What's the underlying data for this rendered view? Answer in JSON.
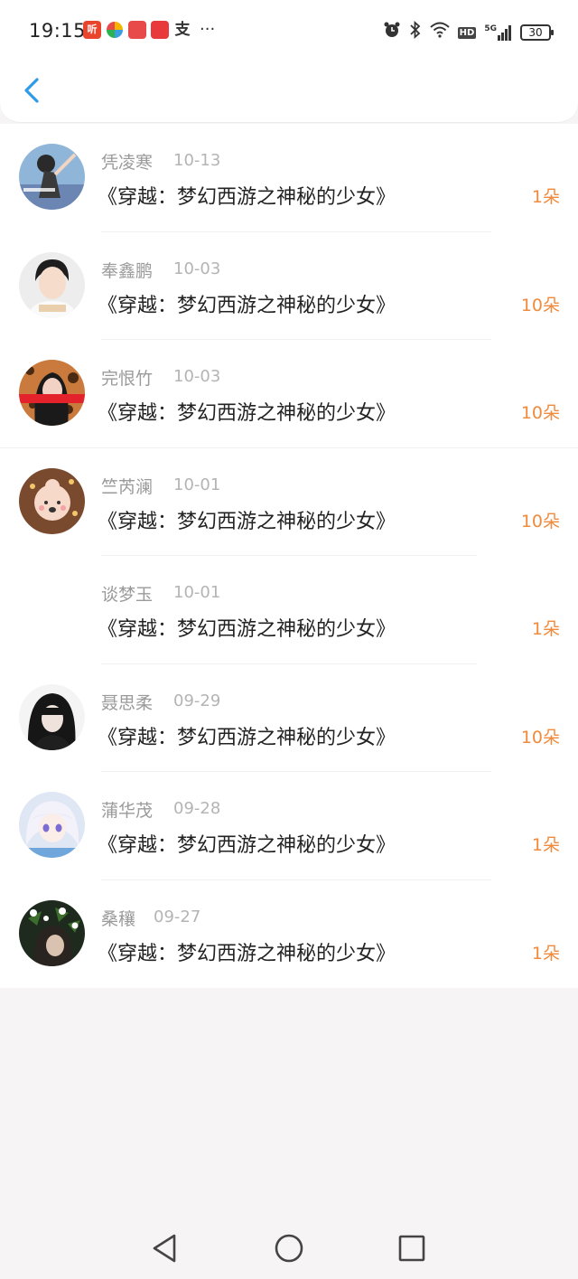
{
  "status_bar": {
    "time": "19:15",
    "notification_apps": [
      {
        "label": "听",
        "color": "#e8452c",
        "icon": "ting-app-icon"
      },
      {
        "label": "",
        "color": "#3a9de0",
        "icon": "pinwheel-app-icon"
      },
      {
        "label": "",
        "color": "#e84a4a",
        "icon": "red-app-icon"
      },
      {
        "label": "",
        "color": "#e83a3a",
        "icon": "red-c-app-icon"
      },
      {
        "label": "支",
        "color": "#333333",
        "icon": "alipay-icon"
      }
    ],
    "more_indicator": "···",
    "network_label": "5G",
    "hd_label": "HD",
    "battery_level": "30"
  },
  "list": {
    "items": [
      {
        "name": "凭凌寒",
        "date": "10-13",
        "title": "《穿越：梦幻西游之神秘的少女》",
        "amount": "1朵",
        "avatar": "sky"
      },
      {
        "name": "奉鑫鹏",
        "date": "10-03",
        "title": "《穿越：梦幻西游之神秘的少女》",
        "amount": "10朵",
        "avatar": "boy"
      },
      {
        "name": "完恨竹",
        "date": "10-03",
        "title": "《穿越：梦幻西游之神秘的少女》",
        "amount": "10朵",
        "avatar": "leopard"
      },
      {
        "name": "竺芮澜",
        "date": "10-01",
        "title": "《穿越：梦幻西游之神秘的少女》",
        "amount": "10朵",
        "avatar": "baby"
      },
      {
        "name": "谈梦玉",
        "date": "10-01",
        "title": "《穿越：梦幻西游之神秘的少女》",
        "amount": "1朵",
        "avatar": "none"
      },
      {
        "name": "聂思柔",
        "date": "09-29",
        "title": "《穿越：梦幻西游之神秘的少女》",
        "amount": "10朵",
        "avatar": "dark"
      },
      {
        "name": "蒲华茂",
        "date": "09-28",
        "title": "《穿越：梦幻西游之神秘的少女》",
        "amount": "1朵",
        "avatar": "anime"
      },
      {
        "name": "桑穰",
        "date": "09-27",
        "title": "《穿越：梦幻西游之神秘的少女》",
        "amount": "1朵",
        "avatar": "flowers"
      }
    ]
  },
  "colors": {
    "accent_blue": "#2f9be8",
    "amount_orange": "#f08a3c",
    "name_gray": "#9a9a9a"
  }
}
